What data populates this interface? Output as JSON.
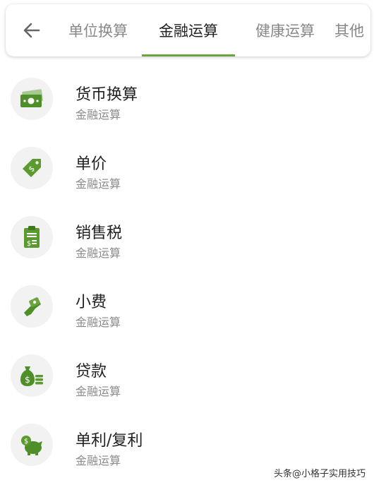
{
  "header": {
    "back_icon": "arrow-left-icon",
    "tabs": [
      {
        "label": "单位换算",
        "active": false
      },
      {
        "label": "金融运算",
        "active": true
      },
      {
        "label": "健康运算",
        "active": false
      },
      {
        "label": "其他",
        "active": false
      }
    ],
    "accent_color": "#6aa53d"
  },
  "items": [
    {
      "title": "货币换算",
      "subtitle": "金融运算",
      "icon": "cash-icon"
    },
    {
      "title": "单价",
      "subtitle": "金融运算",
      "icon": "price-tag-icon"
    },
    {
      "title": "销售税",
      "subtitle": "金融运算",
      "icon": "receipt-icon"
    },
    {
      "title": "小费",
      "subtitle": "金融运算",
      "icon": "tip-hand-icon"
    },
    {
      "title": "贷款",
      "subtitle": "金融运算",
      "icon": "money-bag-icon"
    },
    {
      "title": "单利/复利",
      "subtitle": "金融运算",
      "icon": "piggy-bank-icon"
    }
  ],
  "watermark": "头条@小格子实用技巧"
}
